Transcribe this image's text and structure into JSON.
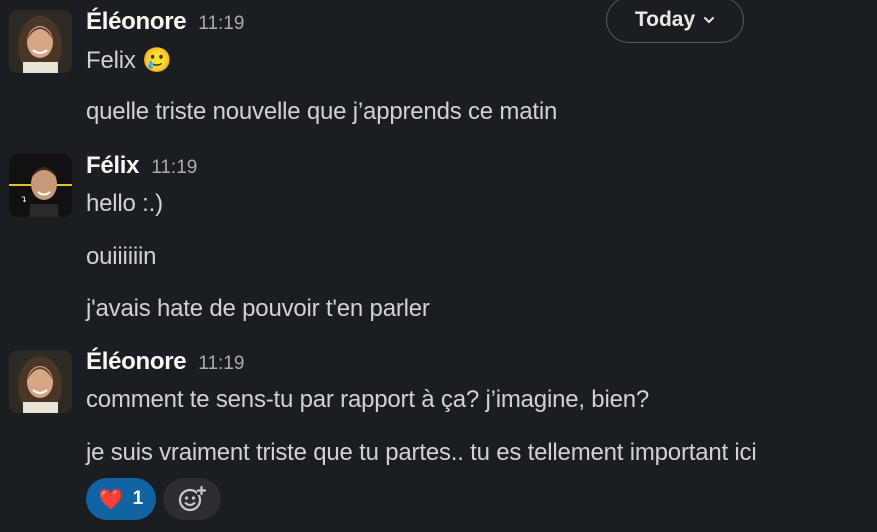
{
  "date_divider": {
    "label": "Today",
    "icon": "chevron-down-icon"
  },
  "messages": [
    {
      "author": "Éléonore",
      "time": "11:19",
      "avatar": "eleonore-avatar",
      "lines": [
        "Felix 🥲",
        "quelle triste nouvelle que j’apprends ce matin"
      ]
    },
    {
      "author": "Félix",
      "time": "11:19",
      "avatar": "felix-avatar",
      "lines": [
        "hello :.)",
        "ouiiiiiin",
        "j'avais hate de pouvoir t'en parler"
      ]
    },
    {
      "author": "Éléonore",
      "time": "11:19",
      "avatar": "eleonore-avatar",
      "lines": [
        "comment te sens-tu par rapport à ça? j’imagine, bien?",
        "je suis vraiment triste que tu partes.. tu es tellement important ici"
      ],
      "reactions": [
        {
          "emoji": "❤️",
          "count": "1"
        }
      ]
    }
  ],
  "add_reaction": {
    "icon": "add-reaction-icon"
  },
  "colors": {
    "background": "#1a1d21",
    "reaction_active": "#1164a3"
  }
}
